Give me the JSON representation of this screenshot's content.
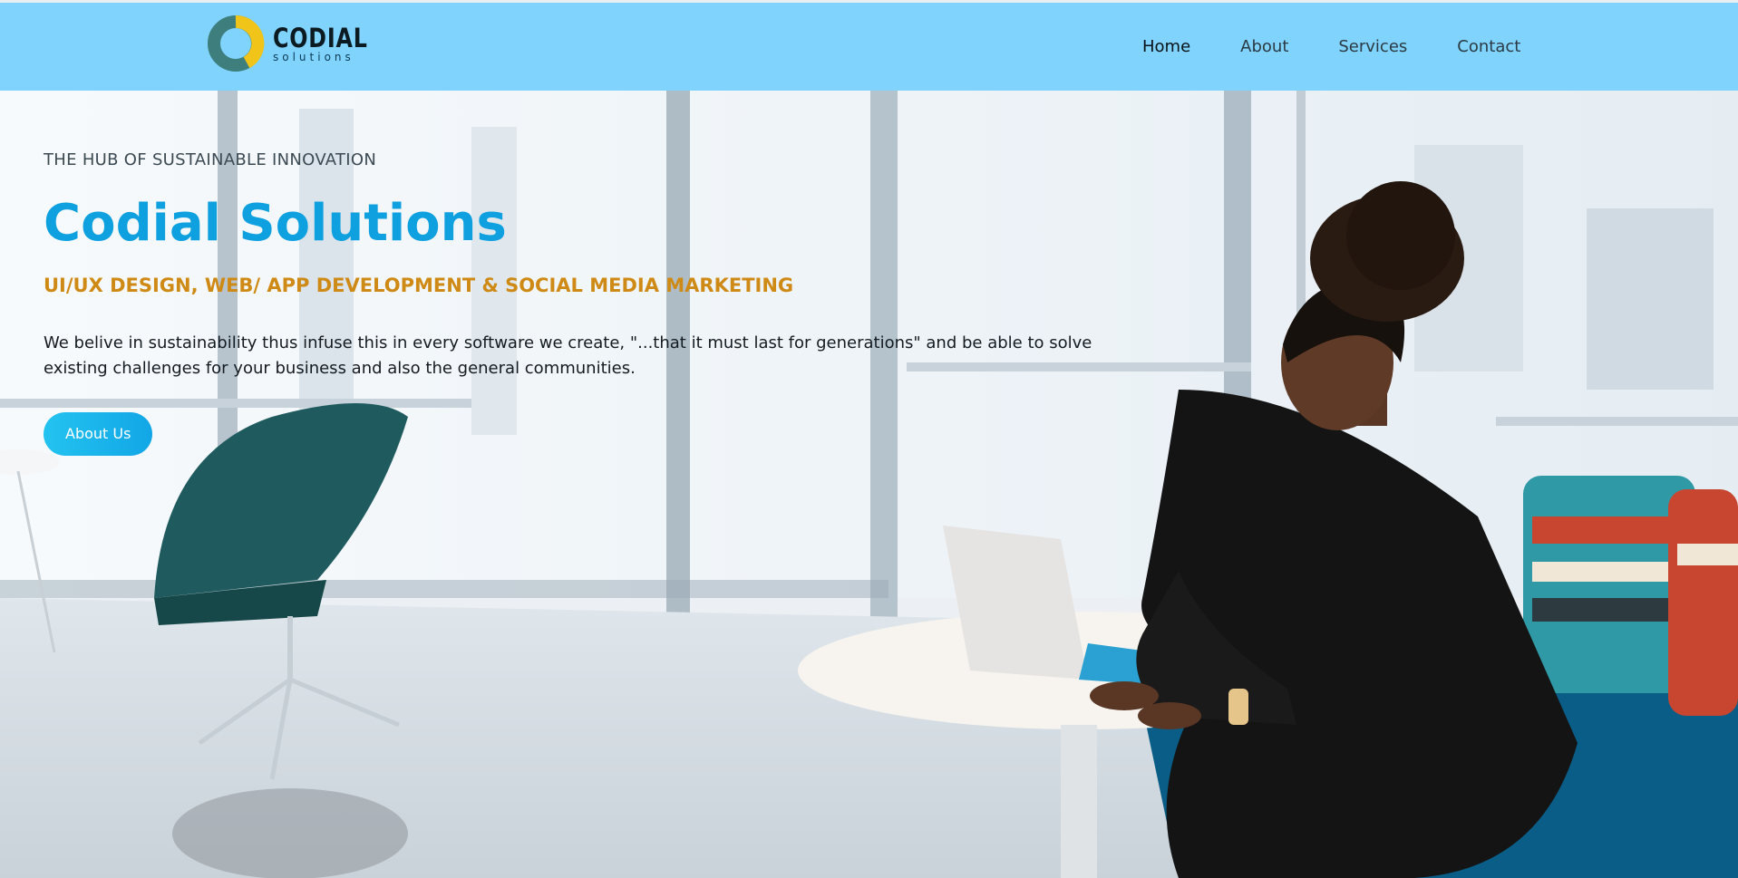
{
  "brand": {
    "name": "CODIAL",
    "sub": "solutions",
    "colors": {
      "ring_dark": "#3e7f7d",
      "ring_yellow": "#f0c419"
    }
  },
  "nav": {
    "items": [
      {
        "label": "Home",
        "active": true
      },
      {
        "label": "About",
        "active": false
      },
      {
        "label": "Services",
        "active": false
      },
      {
        "label": "Contact",
        "active": false
      }
    ]
  },
  "hero": {
    "eyebrow": "THE HUB OF SUSTAINABLE INNOVATION",
    "title": "Codial Solutions",
    "tagline": "UI/UX DESIGN, WEB/ APP DEVELOPMENT & SOCIAL MEDIA MARKETING",
    "description": "We belive in sustainability thus infuse this in every software we create, \"...that it must last for generations\" and be able to solve existing challenges for your business and also the general communities.",
    "cta_label": "About Us"
  },
  "theme": {
    "header_bg": "#7fd3fc",
    "title_color": "#0fa0e0",
    "tagline_color": "#cf8a16",
    "button_color": "#1aaee8"
  }
}
